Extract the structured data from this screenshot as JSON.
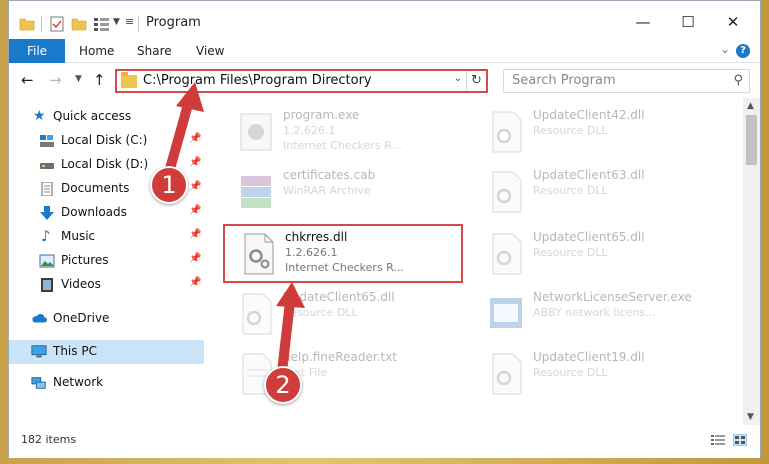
{
  "window": {
    "title": "Program",
    "controls": {
      "minimize": "—",
      "maximize": "☐",
      "close": "✕"
    }
  },
  "ribbon": {
    "tabs": [
      "File",
      "Home",
      "Share",
      "View"
    ],
    "expand": "⌄",
    "help": "?"
  },
  "address": {
    "path": "C:\\Program Files\\Program Directory",
    "search_placeholder": "Search Program"
  },
  "nav_pane": {
    "quick_access": "Quick access",
    "items": [
      {
        "label": "Local Disk (C:)",
        "icon": "drive-icon",
        "pinned": true
      },
      {
        "label": "Local Disk (D:)",
        "icon": "drive-icon",
        "pinned": true
      },
      {
        "label": "Documents",
        "icon": "documents-icon",
        "pinned": true
      },
      {
        "label": "Downloads",
        "icon": "download-icon",
        "pinned": true
      },
      {
        "label": "Music",
        "icon": "music-icon",
        "pinned": true
      },
      {
        "label": "Pictures",
        "icon": "pictures-icon",
        "pinned": true
      },
      {
        "label": "Videos",
        "icon": "videos-icon",
        "pinned": true
      }
    ],
    "onedrive": "OneDrive",
    "this_pc": "This PC",
    "network": "Network"
  },
  "files": [
    {
      "name": "program.exe",
      "line2": "1.2.626.1",
      "line3": "Internet Checkers R...",
      "faded": true
    },
    {
      "name": "UpdateClient42.dll",
      "line2": "Resource DLL",
      "line3": "",
      "faded": true
    },
    {
      "name": "certificates.cab",
      "line2": "WinRAR Archive",
      "line3": "",
      "faded": true
    },
    {
      "name": "UpdateClient63.dll",
      "line2": "Resource DLL",
      "line3": "",
      "faded": true
    },
    {
      "name": "chkrres.dll",
      "line2": "1.2.626.1",
      "line3": "Internet Checkers R...",
      "faded": false
    },
    {
      "name": "UpdateClient65.dll",
      "line2": "Resource DLL",
      "line3": "",
      "faded": true
    },
    {
      "name": "UpdateClient65.dll",
      "line2": "Resource DLL",
      "line3": "",
      "faded": true
    },
    {
      "name": "NetworkLicenseServer.exe",
      "line2": "ABBY network licens...",
      "line3": "",
      "faded": true
    },
    {
      "name": "help.fineReader.txt",
      "line2": "Text File",
      "line3": "",
      "faded": true
    },
    {
      "name": "UpdateClient19.dll",
      "line2": "Resource DLL",
      "line3": "",
      "faded": true
    }
  ],
  "status": {
    "count": "182 items"
  },
  "annotations": {
    "step1": "1",
    "step2": "2",
    "color": "#d03b3b"
  }
}
